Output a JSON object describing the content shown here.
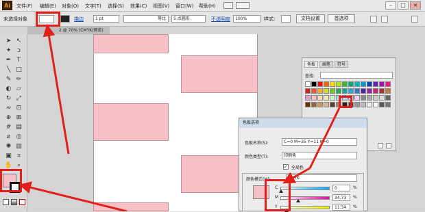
{
  "menubar": {
    "app_logo": "Ai",
    "items": [
      "文件(F)",
      "编辑(E)",
      "对象(O)",
      "文字(T)",
      "选择(S)",
      "效果(C)",
      "视图(V)",
      "窗口(W)",
      "帮助(H)"
    ]
  },
  "control_bar": {
    "selection_label": "未选择对象",
    "describe_label": "描边",
    "stroke_weight": "1 pt",
    "stroke_profile": "等比",
    "brush": "5 点圆形",
    "opacity_label": "不透明度",
    "opacity_value": "100%",
    "style_label": "样式:",
    "doc_setup_button": "文档设置",
    "prefs_button": "首选项"
  },
  "document_tab": "2 @ 70% (CMYK/预览)",
  "swatches_panel": {
    "tabs": [
      "色板",
      "画笔",
      "符号"
    ],
    "search_label": "查找:",
    "colors": {
      "accent_red": "#e0201a",
      "pink": "#f6c1c6"
    }
  },
  "swatch_dialog": {
    "title": "色板选项",
    "name_label": "色板名称(S):",
    "name_value": "C=0 M=35 Y=11 K=0",
    "type_label": "颜色类型(T):",
    "type_value": "印刷色",
    "global_label": "全局色",
    "mode_label": "颜色模式(M):",
    "mode_value": "CMYK",
    "channels": [
      {
        "name": "C",
        "value": "0",
        "unit": "%",
        "level": 0.0
      },
      {
        "name": "M",
        "value": "34.73",
        "unit": "%",
        "level": 0.347
      },
      {
        "name": "Y",
        "value": "11.34",
        "unit": "%",
        "level": 0.113
      }
    ]
  }
}
